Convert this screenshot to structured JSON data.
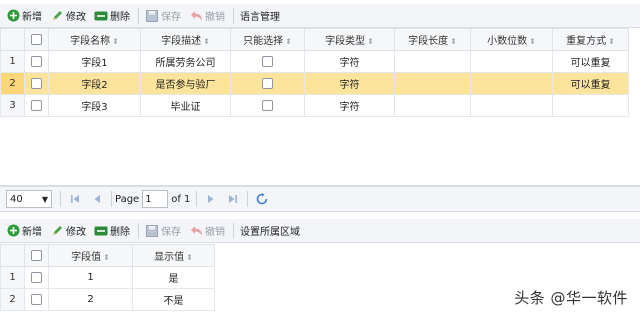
{
  "top_toolbar": {
    "add": "新增",
    "edit": "修改",
    "delete": "删除",
    "save": "保存",
    "undo": "撤销",
    "lang": "语言管理"
  },
  "top_grid": {
    "headers": [
      "字段名称",
      "字段描述",
      "只能选择",
      "字段类型",
      "字段长度",
      "小数位数",
      "重复方式"
    ],
    "rows": [
      {
        "num": "1",
        "name": "字段1",
        "desc": "所属劳务公司",
        "type": "字符",
        "length": "",
        "decimals": "",
        "repeat": "可以重复"
      },
      {
        "num": "2",
        "name": "字段2",
        "desc": "是否参与验厂",
        "type": "字符",
        "length": "",
        "decimals": "",
        "repeat": "可以重复"
      },
      {
        "num": "3",
        "name": "字段3",
        "desc": "毕业证",
        "type": "字符",
        "length": "",
        "decimals": "",
        "repeat": ""
      }
    ]
  },
  "pager": {
    "page_size": "40",
    "page_label": "Page",
    "page_value": "1",
    "of_label": "of 1"
  },
  "bottom_toolbar": {
    "add": "新增",
    "edit": "修改",
    "delete": "删除",
    "save": "保存",
    "undo": "撤销",
    "area": "设置所属区域"
  },
  "bottom_grid": {
    "headers": [
      "字段值",
      "显示值"
    ],
    "rows": [
      {
        "num": "1",
        "value": "1",
        "display": "是"
      },
      {
        "num": "2",
        "value": "2",
        "display": "不是"
      }
    ]
  },
  "watermark": "头条 @华一软件",
  "colors": {
    "selected_row": "#fde49c",
    "add_green": "#2e9b3a",
    "delete_green": "#2e8b3a",
    "edit_green": "#3b9b3a"
  }
}
